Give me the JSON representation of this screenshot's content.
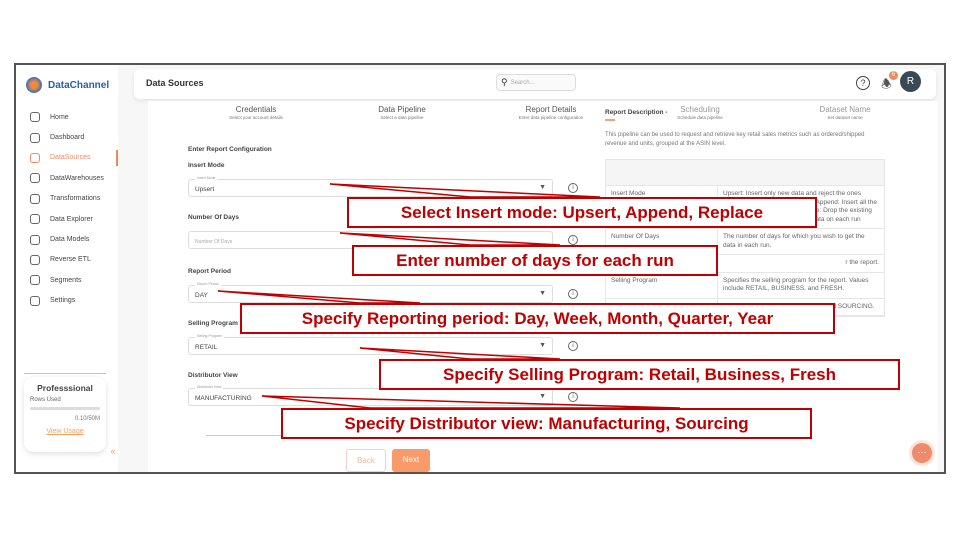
{
  "brand": {
    "name": "DataChannel"
  },
  "sidebar": {
    "items": [
      {
        "label": "Home",
        "icon": "home-icon"
      },
      {
        "label": "Dashboard",
        "icon": "dashboard-icon"
      },
      {
        "label": "DataSources",
        "icon": "datasources-icon",
        "active": true
      },
      {
        "label": "DataWarehouses",
        "icon": "layers-icon"
      },
      {
        "label": "Transformations",
        "icon": "transform-icon"
      },
      {
        "label": "Data Explorer",
        "icon": "explorer-icon"
      },
      {
        "label": "Data Models",
        "icon": "models-icon"
      },
      {
        "label": "Reverse ETL",
        "icon": "reverse-etl-icon"
      },
      {
        "label": "Segments",
        "icon": "segments-icon"
      },
      {
        "label": "Settings",
        "icon": "gear-icon"
      }
    ],
    "plan": {
      "title": "Professsional",
      "rows_label": "Rows Used",
      "usage": "0.10/50M",
      "usage_fraction": 0.002,
      "link": "View Usage"
    },
    "collapse": "«"
  },
  "header": {
    "title": "Data Sources",
    "search_placeholder": "Search...",
    "notifications": "6",
    "avatar": "R"
  },
  "steps": [
    {
      "title": "Credentials",
      "sub": "Select your account details"
    },
    {
      "title": "Data Pipeline",
      "sub": "Select a data pipeline"
    },
    {
      "title": "Report Details",
      "sub": "Enter data pipeline configuration"
    },
    {
      "title": "Scheduling",
      "sub": "Schedule data pipeline"
    },
    {
      "title": "Dataset Name",
      "sub": "Set dataset name"
    }
  ],
  "form": {
    "section": "Enter Report Configuration",
    "fields": [
      {
        "label": "Insert Mode",
        "float": "Insert Mode",
        "value": "Upsert"
      },
      {
        "label": "Number Of Days",
        "placeholder": "Number Of Days"
      },
      {
        "label": "Report Period",
        "float": "Report Period",
        "value": "DAY"
      },
      {
        "label": "Selling Program",
        "float": "Selling Program",
        "value": "RETAIL"
      },
      {
        "label": "Distributor View",
        "float": "Distributor View",
        "value": "MANUFACTURING"
      }
    ],
    "back": "Back",
    "next": "Next"
  },
  "report": {
    "title": "Report Description -",
    "desc": "This pipeline can be used to request and retrieve key retail sales metrics such as ordered/shipped revenue and units, grouped at the ASIN level.",
    "rows": [
      {
        "k": "Insert Mode",
        "v": "Upsert: Insert only new data and reject the ones already present in the database Append: Insert all the rows even if its duplicate Replace: Drop the existing table and recreate it with fresh data on each run"
      },
      {
        "k": "Number Of Days",
        "v": "The number of days for which you wish to get the data in each run."
      },
      {
        "k": "",
        "v": "r the report."
      },
      {
        "k": "Selling Program",
        "v": "Specifies the selling program for the report. Values include RETAIL, BUSINESS, and FRESH."
      },
      {
        "k": "",
        "v": "Values include MANUFACTURING and SOURCING."
      }
    ]
  },
  "callouts": [
    "Select Insert mode: Upsert, Append, Replace",
    "Enter number of days for each run",
    "Specify Reporting period: Day, Week, Month, Quarter, Year",
    "Specify Selling Program: Retail, Business, Fresh",
    "Specify Distributor view: Manufacturing, Sourcing"
  ],
  "colors": {
    "accent": "#f08a5c",
    "callout": "#c00000"
  }
}
